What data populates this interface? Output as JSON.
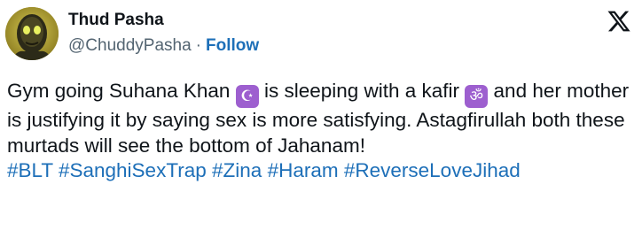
{
  "author": {
    "display_name": "Thud Pasha",
    "handle": "@ChuddyPasha",
    "separator": "·",
    "follow_label": "Follow"
  },
  "icons": {
    "avatar": "alien-face-avatar",
    "platform_logo": "x-logo-icon",
    "emoji_1": "star-and-crescent-icon",
    "emoji_2": "om-symbol-icon"
  },
  "tweet": {
    "text_part_1": "Gym going Suhana Khan ",
    "emoji_1_glyph": "☪",
    "text_part_2": " is sleeping with a kafir ",
    "emoji_2_glyph": "ॐ",
    "text_part_3": " and her mother is justifying it by saying sex is more satisfying. Astagfirullah both these murtads will see the bottom of Jahanam!",
    "hashtags": [
      "#BLT",
      "#SanghiSexTrap",
      "#Zina",
      "#Haram",
      "#ReverseLoveJihad"
    ]
  },
  "colors": {
    "link": "#1d6fb8",
    "secondary_text": "#536471",
    "emoji_bg": "#9d5fcf"
  }
}
